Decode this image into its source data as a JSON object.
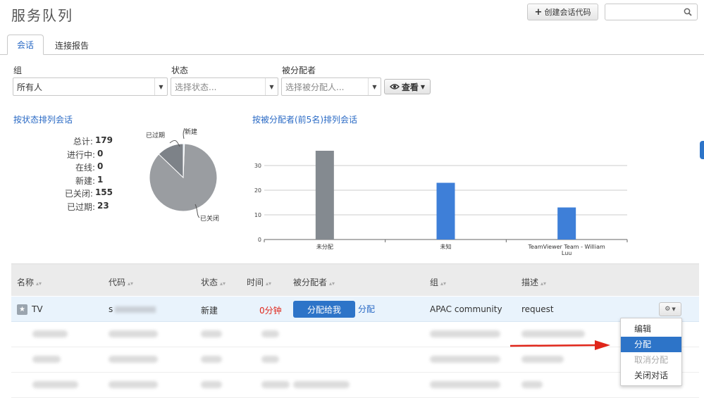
{
  "page": {
    "title": "服务队列"
  },
  "header": {
    "create_label": "创建会话代码",
    "search_value": ""
  },
  "tabs": {
    "sessions": "会话",
    "connection_report": "连接报告"
  },
  "filters": {
    "group": {
      "label": "组",
      "value": "所有人"
    },
    "status": {
      "label": "状态",
      "placeholder": "选择状态..."
    },
    "assignee": {
      "label": "被分配者",
      "placeholder": "选择被分配人..."
    },
    "view_label": "查看"
  },
  "status_summary": {
    "title": "按状态排列会话",
    "rows": [
      {
        "label": "总计:",
        "value": "179"
      },
      {
        "label": "进行中:",
        "value": "0"
      },
      {
        "label": "在线:",
        "value": "0"
      },
      {
        "label": "新建:",
        "value": "1"
      },
      {
        "label": "已关闭:",
        "value": "155"
      },
      {
        "label": "已过期:",
        "value": "23"
      }
    ]
  },
  "pie_labels": {
    "expired": "已过期",
    "new": "新建",
    "closed": "已关闭"
  },
  "bar_chart_title": "按被分配者(前5名)排列会话",
  "chart_data": [
    {
      "type": "pie",
      "categories": [
        "已关闭",
        "已过期",
        "新建"
      ],
      "values": [
        155,
        23,
        1
      ],
      "colors": [
        "#9a9da1",
        "#7d8288",
        "#c7dff2"
      ]
    },
    {
      "type": "bar",
      "categories": [
        "未分配",
        "未知",
        "TeamViewer Team - William Luu"
      ],
      "values": [
        36,
        23,
        13
      ],
      "colors": [
        "#848a90",
        "#3e7fd8",
        "#3e7fd8"
      ],
      "yticks": [
        0,
        10,
        20,
        30
      ],
      "ylim": [
        0,
        40
      ],
      "grid": true
    }
  ],
  "table": {
    "headers": [
      "名称",
      "代码",
      "状态",
      "时间",
      "被分配者",
      "组",
      "描述"
    ],
    "row1": {
      "name": "TV",
      "code": "s",
      "status": "新建",
      "time": "0分钟",
      "assign_me": "分配给我",
      "assign": "分配",
      "group": "APAC community",
      "description": "request"
    }
  },
  "menu": {
    "items": [
      "编辑",
      "分配",
      "取消分配",
      "关闭对话"
    ]
  },
  "colors": {
    "accent": "#2d74c8",
    "link": "#2a6ac5",
    "time_red": "#e0261a",
    "arrow": "#e0261a"
  }
}
